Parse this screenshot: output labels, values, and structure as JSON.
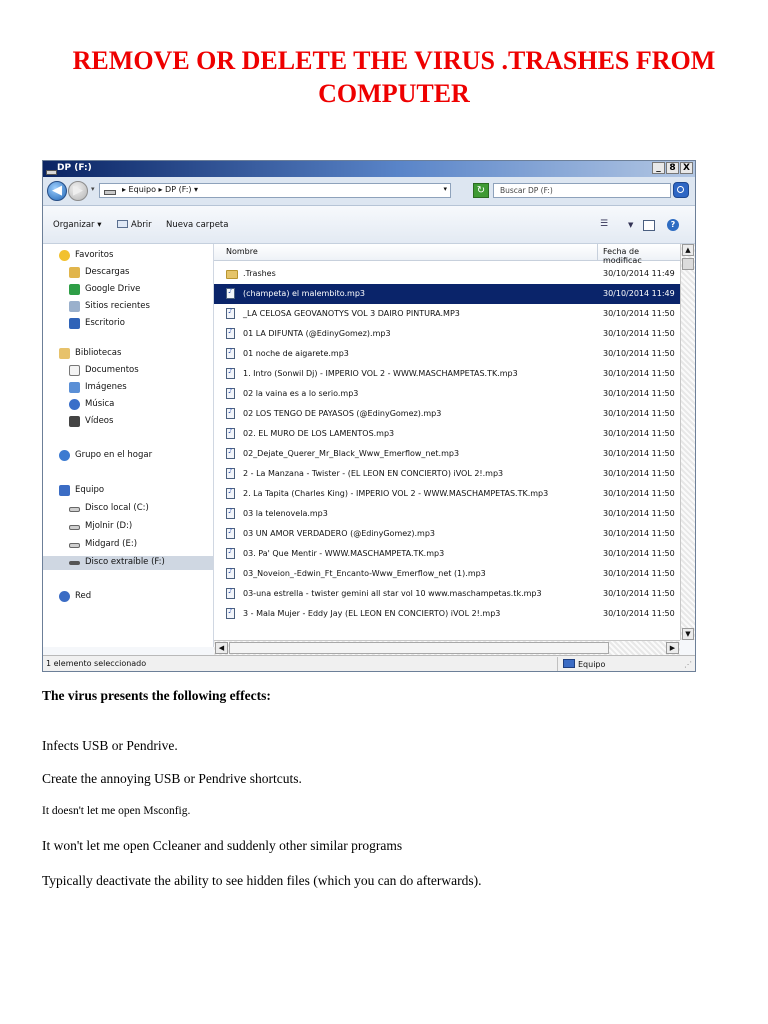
{
  "document": {
    "title_line1": "REMOVE OR DELETE THE VIRUS .TRASHES FROM",
    "title_line2": "COMPUTER",
    "effects_heading": "The virus presents the following effects:",
    "effects": [
      "Infects USB or Pendrive.",
      "Create the annoying USB or Pendrive shortcuts.",
      "It doesn't let me open Msconfig.",
      "It won't let me open Ccleaner and suddenly other similar programs",
      "Typically deactivate the ability to see hidden files (which you can do afterwards)."
    ]
  },
  "window": {
    "title": "DP (F:)",
    "buttons": {
      "minimize": "_",
      "maximize": "8",
      "close": "X"
    },
    "address": {
      "breadcrumb": "▸ Equipo ▸ DP (F:) ▾"
    },
    "search": {
      "placeholder": "Buscar DP (F:)"
    },
    "toolbar": {
      "organize": "Organizar ▾",
      "open": "Abrir",
      "new_folder": "Nueva carpeta"
    },
    "nav": {
      "favorites": "Favoritos",
      "descargas": "Descargas",
      "google_drive": "Google Drive",
      "sitios": "Sitios recientes",
      "escritorio": "Escritorio",
      "bibliotecas": "Bibliotecas",
      "documentos": "Documentos",
      "imagenes": "Imágenes",
      "musica": "Música",
      "videos": "Vídeos",
      "grupo": "Grupo en el hogar",
      "equipo": "Equipo",
      "disco_c": "Disco local (C:)",
      "disco_d": "Mjolnir (D:)",
      "disco_e": "Midgard (E:)",
      "disco_f": "Disco extraíble (F:)",
      "red": "Red"
    },
    "columns": {
      "name": "Nombre",
      "date": "Fecha de modificac"
    },
    "files": [
      {
        "name": ".Trashes",
        "date": "30/10/2014 11:49"
      },
      {
        "name": "(champeta) el malembito.mp3",
        "date": "30/10/2014 11:49"
      },
      {
        "name": "_LA CELOSA GEOVANOTYS VOL 3 DAIRO PINTURA.MP3",
        "date": "30/10/2014 11:50"
      },
      {
        "name": "01 LA DIFUNTA (@EdinyGomez).mp3",
        "date": "30/10/2014 11:50"
      },
      {
        "name": "01 noche de aigarete.mp3",
        "date": "30/10/2014 11:50"
      },
      {
        "name": "1. Intro (Sonwil Dj) - IMPERIO VOL 2 - WWW.MASCHAMPETAS.TK.mp3",
        "date": "30/10/2014 11:50"
      },
      {
        "name": "02 la vaina es a lo serio.mp3",
        "date": "30/10/2014 11:50"
      },
      {
        "name": "02 LOS TENGO DE PAYASOS (@EdinyGomez).mp3",
        "date": "30/10/2014 11:50"
      },
      {
        "name": "02. EL MURO DE LOS LAMENTOS.mp3",
        "date": "30/10/2014 11:50"
      },
      {
        "name": "02_Dejate_Querer_Mr_Black_Www_Emerflow_net.mp3",
        "date": "30/10/2014 11:50"
      },
      {
        "name": "2 - La Manzana - Twister - (EL LEON EN CONCIERTO) iVOL 2!.mp3",
        "date": "30/10/2014 11:50"
      },
      {
        "name": "2. La Tapita (Charles King) - IMPERIO VOL 2 - WWW.MASCHAMPETAS.TK.mp3",
        "date": "30/10/2014 11:50"
      },
      {
        "name": "03 la telenovela.mp3",
        "date": "30/10/2014 11:50"
      },
      {
        "name": "03 UN AMOR VERDADERO (@EdinyGomez).mp3",
        "date": "30/10/2014 11:50"
      },
      {
        "name": "03. Pa' Que Mentir - WWW.MASCHAMPETA.TK.mp3",
        "date": "30/10/2014 11:50"
      },
      {
        "name": "03_Noveion_-Edwin_Ft_Encanto-Www_Emerflow_net (1).mp3",
        "date": "30/10/2014 11:50"
      },
      {
        "name": "03-una estrella - twister gemini all star vol 10 www.maschampetas.tk.mp3",
        "date": "30/10/2014 11:50"
      },
      {
        "name": "3 - Mala Mujer - Eddy Jay (EL LEON EN CONCIERTO) iVOL 2!.mp3",
        "date": "30/10/2014 11:50"
      }
    ],
    "status": {
      "selected": "1 elemento seleccionado",
      "computer": "Equipo"
    }
  }
}
